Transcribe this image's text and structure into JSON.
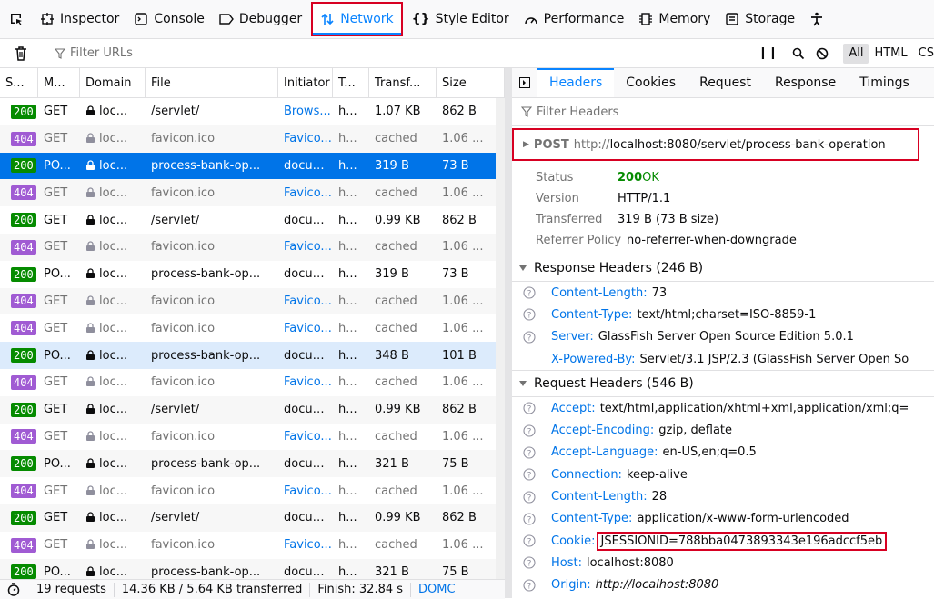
{
  "toolbar": {
    "tabs": [
      {
        "label": "Inspector"
      },
      {
        "label": "Console"
      },
      {
        "label": "Debugger"
      },
      {
        "label": "Network"
      },
      {
        "label": "Style Editor"
      },
      {
        "label": "Performance"
      },
      {
        "label": "Memory"
      },
      {
        "label": "Storage"
      }
    ]
  },
  "filterbar": {
    "placeholder": "Filter URLs",
    "types": [
      "All",
      "HTML",
      "CS"
    ]
  },
  "requests": {
    "columns": [
      "S...",
      "M...",
      "Domain",
      "File",
      "Initiator",
      "T...",
      "Transf...",
      "Size"
    ],
    "rows": [
      {
        "status": "200",
        "method": "GET",
        "domain": "loc...",
        "file": "/servlet/",
        "initiator": "Brows...",
        "type": "h...",
        "transferred": "1.07 KB",
        "size": "862 B"
      },
      {
        "status": "404",
        "method": "GET",
        "domain": "loc...",
        "file": "favicon.ico",
        "initiator": "Favico...",
        "type": "h...",
        "transferred": "cached",
        "size": "1.06 ..."
      },
      {
        "status": "200",
        "method": "PO...",
        "domain": "loc...",
        "file": "process-bank-op...",
        "initiator": "docum...",
        "type": "h...",
        "transferred": "319 B",
        "size": "73 B"
      },
      {
        "status": "404",
        "method": "GET",
        "domain": "loc...",
        "file": "favicon.ico",
        "initiator": "Favico...",
        "type": "h...",
        "transferred": "cached",
        "size": "1.06 ..."
      },
      {
        "status": "200",
        "method": "GET",
        "domain": "loc...",
        "file": "/servlet/",
        "initiator": "docum...",
        "type": "h...",
        "transferred": "0.99 KB",
        "size": "862 B"
      },
      {
        "status": "404",
        "method": "GET",
        "domain": "loc...",
        "file": "favicon.ico",
        "initiator": "Favico...",
        "type": "h...",
        "transferred": "cached",
        "size": "1.06 ..."
      },
      {
        "status": "200",
        "method": "PO...",
        "domain": "loc...",
        "file": "process-bank-op...",
        "initiator": "docum...",
        "type": "h...",
        "transferred": "319 B",
        "size": "73 B"
      },
      {
        "status": "404",
        "method": "GET",
        "domain": "loc...",
        "file": "favicon.ico",
        "initiator": "Favico...",
        "type": "h...",
        "transferred": "cached",
        "size": "1.06 ..."
      },
      {
        "status": "404",
        "method": "GET",
        "domain": "loc...",
        "file": "favicon.ico",
        "initiator": "Favico...",
        "type": "h...",
        "transferred": "cached",
        "size": "1.06 ..."
      },
      {
        "status": "200",
        "method": "PO...",
        "domain": "loc...",
        "file": "process-bank-op...",
        "initiator": "docum...",
        "type": "h...",
        "transferred": "348 B",
        "size": "101 B"
      },
      {
        "status": "404",
        "method": "GET",
        "domain": "loc...",
        "file": "favicon.ico",
        "initiator": "Favico...",
        "type": "h...",
        "transferred": "cached",
        "size": "1.06 ..."
      },
      {
        "status": "200",
        "method": "GET",
        "domain": "loc...",
        "file": "/servlet/",
        "initiator": "docum...",
        "type": "h...",
        "transferred": "0.99 KB",
        "size": "862 B"
      },
      {
        "status": "404",
        "method": "GET",
        "domain": "loc...",
        "file": "favicon.ico",
        "initiator": "Favico...",
        "type": "h...",
        "transferred": "cached",
        "size": "1.06 ..."
      },
      {
        "status": "200",
        "method": "PO...",
        "domain": "loc...",
        "file": "process-bank-op...",
        "initiator": "docum...",
        "type": "h...",
        "transferred": "321 B",
        "size": "75 B"
      },
      {
        "status": "404",
        "method": "GET",
        "domain": "loc...",
        "file": "favicon.ico",
        "initiator": "Favico...",
        "type": "h...",
        "transferred": "cached",
        "size": "1.06 ..."
      },
      {
        "status": "200",
        "method": "GET",
        "domain": "loc...",
        "file": "/servlet/",
        "initiator": "docum...",
        "type": "h...",
        "transferred": "0.99 KB",
        "size": "862 B"
      },
      {
        "status": "404",
        "method": "GET",
        "domain": "loc...",
        "file": "favicon.ico",
        "initiator": "Favico...",
        "type": "h...",
        "transferred": "cached",
        "size": "1.06 ..."
      },
      {
        "status": "200",
        "method": "PO...",
        "domain": "loc...",
        "file": "process-bank-op...",
        "initiator": "docum...",
        "type": "h...",
        "transferred": "321 B",
        "size": "75 B"
      }
    ]
  },
  "statusbar": {
    "requests": "19 requests",
    "transferred": "14.36 KB / 5.64 KB transferred",
    "finish": "Finish: 32.84 s",
    "dom": "DOMC"
  },
  "details": {
    "tabs": [
      "Headers",
      "Cookies",
      "Request",
      "Response",
      "Timings"
    ],
    "filter_placeholder": "Filter Headers",
    "method": "POST",
    "url_host": "http://",
    "url_path": "localhost:8080/servlet/process-bank-operation",
    "summary": [
      {
        "key": "Status",
        "value": "OK",
        "code": "200"
      },
      {
        "key": "Version",
        "value": "HTTP/1.1"
      },
      {
        "key": "Transferred",
        "value": "319 B (73 B size)"
      },
      {
        "key": "Referrer Policy",
        "value": "no-referrer-when-downgrade"
      }
    ],
    "response_title": "Response Headers (246 B)",
    "response_headers": [
      {
        "k": "Content-Length:",
        "v": "73"
      },
      {
        "k": "Content-Type:",
        "v": "text/html;charset=ISO-8859-1"
      },
      {
        "k": "Server:",
        "v": "GlassFish Server Open Source Edition 5.0.1"
      },
      {
        "k": "X-Powered-By:",
        "v": "Servlet/3.1 JSP/2.3 (GlassFish Server Open So"
      }
    ],
    "request_title": "Request Headers (546 B)",
    "request_headers": [
      {
        "k": "Accept:",
        "v": "text/html,application/xhtml+xml,application/xml;q="
      },
      {
        "k": "Accept-Encoding:",
        "v": "gzip, deflate"
      },
      {
        "k": "Accept-Language:",
        "v": "en-US,en;q=0.5"
      },
      {
        "k": "Connection:",
        "v": "keep-alive"
      },
      {
        "k": "Content-Length:",
        "v": "28"
      },
      {
        "k": "Content-Type:",
        "v": "application/x-www-form-urlencoded"
      },
      {
        "k": "Cookie:",
        "v": "JSESSIONID=788bba0473893343e196adccf5eb"
      },
      {
        "k": "Host:",
        "v": "localhost:8080"
      },
      {
        "k": "Origin:",
        "v": "http://localhost:8080"
      }
    ]
  }
}
